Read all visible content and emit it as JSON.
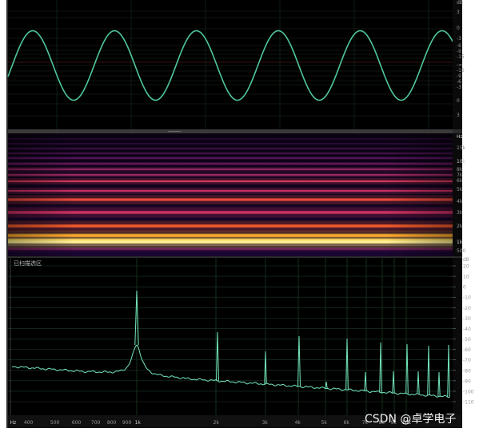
{
  "waveform": {
    "db_labels": [
      "dB",
      "3",
      "0",
      "-3",
      "-6",
      "-9",
      "-15",
      "-∞",
      "-15",
      "-9",
      "-6",
      "-3",
      "0",
      "3"
    ]
  },
  "spectrogram": {
    "hz_labels": [
      "Hz",
      "15k",
      "10k",
      "8k",
      "7k",
      "6k",
      "5k",
      "4k",
      "3k",
      "2k",
      "1k",
      "500"
    ]
  },
  "spectrum": {
    "title": "已扫描选区",
    "db_labels": [
      "dB",
      "20",
      "10",
      "0",
      "-10",
      "-20",
      "-30",
      "-40",
      "-50",
      "-60",
      "-70",
      "-80",
      "-90",
      "-100",
      "-110"
    ],
    "freq_labels": [
      "Hz",
      "400",
      "500",
      "600",
      "700",
      "800",
      "900",
      "1k",
      "2k",
      "3k",
      "4k",
      "5k",
      "6k",
      "7k",
      "8k",
      "9k",
      "10k"
    ]
  },
  "watermark": "CSDN @卓学电子",
  "colors": {
    "wave": "#4fc79a",
    "spectrum_line": "#74e8bc",
    "panel_bg": "#000000",
    "frame": "#2e2e2e"
  }
}
